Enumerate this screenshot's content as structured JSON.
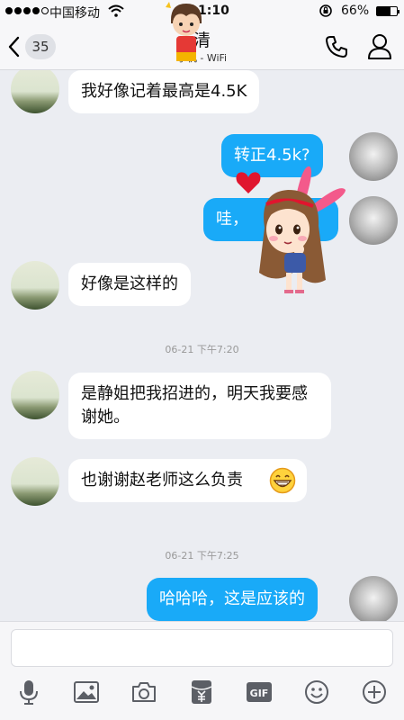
{
  "status_bar": {
    "carrier": "中国移动",
    "time": "1:10",
    "battery": "66%",
    "battery_level": 0.66
  },
  "nav": {
    "unread_count": "35",
    "title": "清",
    "subtitle": "手机 - WiFi"
  },
  "chat": {
    "messages": [
      {
        "side": "in",
        "text": "我好像记着最高是4.5K"
      },
      {
        "side": "out",
        "text": "转正4.5k?"
      },
      {
        "side": "out",
        "text": "哇，"
      },
      {
        "side": "in",
        "text": "好像是这样的"
      },
      {
        "side": "in",
        "text": "是静姐把我招进的，明天我要感谢她。"
      },
      {
        "side": "in",
        "text": "也谢谢赵老师这么负责"
      },
      {
        "side": "out",
        "text": "哈哈哈，这是应该的"
      }
    ],
    "timestamps": [
      "06-21 下午7:20",
      "06-21 下午7:25"
    ]
  },
  "input": {
    "placeholder": ""
  },
  "toolbar": {
    "icons": [
      "microphone-icon",
      "image-icon",
      "camera-icon",
      "red-packet-icon",
      "gif-icon",
      "emoji-icon",
      "plus-icon"
    ]
  },
  "colors": {
    "outgoing_bubble": "#19aaf8",
    "incoming_bubble": "#ffffff",
    "background": "#ebedf2"
  }
}
